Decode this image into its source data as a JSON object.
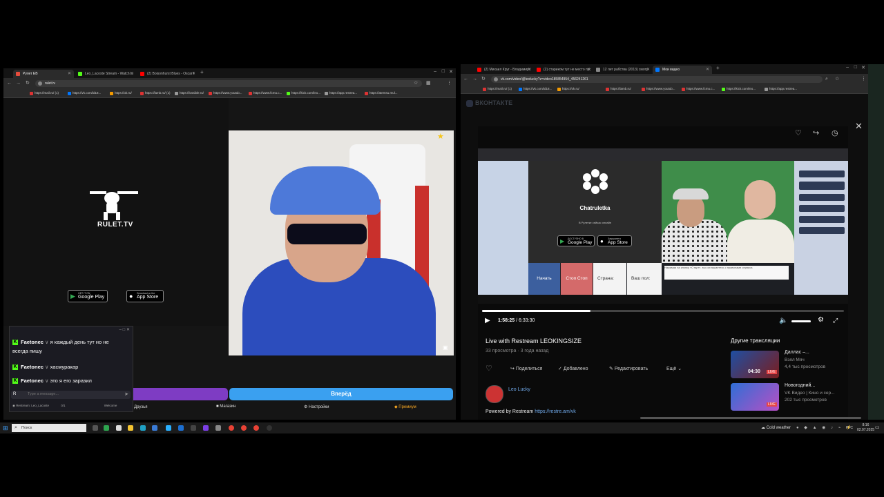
{
  "left_window": {
    "tabs": [
      {
        "title": "Рулет ЕВ",
        "color": "#e74c3c"
      },
      {
        "title": "Leo_Lacoste Stream - Watch Li",
        "color": "#53fc18"
      },
      {
        "title": "(2) Boisonhurst Blues - Oscar I",
        "color": "#ff0000"
      }
    ],
    "url": "rulet.tv",
    "bookmarks": [
      "https://mail.ru/ (1)",
      "https://vk.com/id18...",
      "https://ok.ru/",
      "https://lamb.ru/ (1)",
      "https://lossible.ru/",
      "https://www.youtub...",
      "https://www.fcmu.c...",
      "https://kick.com/leo...",
      "https://app.restrea...",
      "https://atemsu.mul..."
    ]
  },
  "rulet": {
    "logo": "RULET.TV",
    "google_play_small": "GET IT ON",
    "google_play": "Google Play",
    "app_store_small": "Download on the",
    "app_store": "App Store",
    "next_button": "Вперёд",
    "nav": [
      "Друзья",
      "Магазин",
      "Настройки",
      "Премиум"
    ]
  },
  "chat": {
    "messages": [
      {
        "user": "Faetonec",
        "text": "я каждый день тут но не"
      },
      {
        "user": "",
        "text": "всегда пишу"
      },
      {
        "user": "Faetonec",
        "text": "хасмуракар"
      },
      {
        "user": "Faetonec",
        "text": "это я его заразил"
      }
    ],
    "input_placeholder": "Type a message...",
    "footer": "Restream: Leo_Lacoste",
    "stats": "0/1",
    "send_label": "Welcome"
  },
  "right_window": {
    "tabs": [
      {
        "title": "(2) Михаил Круг - Владимирс",
        "color": "#ff0000"
      },
      {
        "title": "(2) стариком тут не место пус",
        "color": "#ff0000"
      },
      {
        "title": "12 лет рабства (2013) смотр",
        "color": "#888888"
      },
      {
        "title": "Мои видео",
        "color": "#0077ff"
      }
    ],
    "url": "vk.com/video/@leolucky?z=video185854954_456241261",
    "bookmarks": [
      "https://mail.ru/ (1)",
      "https://vk.com/id18...",
      "https://ok.ru/",
      "https://lamb.ru/",
      "https://www.youtub...",
      "https://www.fcmu.c...",
      "https://kick.com/leo...",
      "https://app.restrea..."
    ]
  },
  "vk": {
    "brand": "ВКОНТАКТЕ",
    "player": {
      "current": "1:58:25",
      "separator": "/",
      "total": "6:33:30",
      "progress": 0.3
    },
    "inner_site": {
      "brand": "Chatruletka",
      "users_line": "В Рулетке сейчас онлайн",
      "google_small": "ДОСТУПНО В",
      "google": "Google Play",
      "apple_small": "Загрузите в",
      "apple": "App Store",
      "start": "Начать",
      "stop": "Стоп Стоп",
      "country": "Страна:",
      "gender": "Ваш пол:",
      "hint": "Нажимая на кнопку «Старт», вы соглашаетесь с правилами сервиса"
    },
    "title": "Live with Restream LEOKINGSIZE",
    "views": "33 просмотра",
    "ago": "3 года назад",
    "actions": [
      "Поделиться",
      "Добавлено",
      "Редактировать",
      "Ещё"
    ],
    "author": "Leo Lucky",
    "powered_prefix": "Powered by Restream",
    "powered_link": "https://restre.am/vk",
    "related_header": "Другие трансляции",
    "related": [
      {
        "title": "Даллас –...",
        "channel": "Взял Мяч",
        "meta": "4,4 тыс просмотров",
        "badge": "04:30"
      },
      {
        "title": "Новогодний...",
        "channel": "VK Видео | Кино и сер...",
        "meta": "202 тыс просмотров",
        "badge": "LIVE"
      }
    ]
  },
  "taskbar": {
    "search": "Поиск",
    "weather": "Cold weather",
    "lang": "РУС",
    "time": "8:16",
    "date": "02.07.2025"
  }
}
